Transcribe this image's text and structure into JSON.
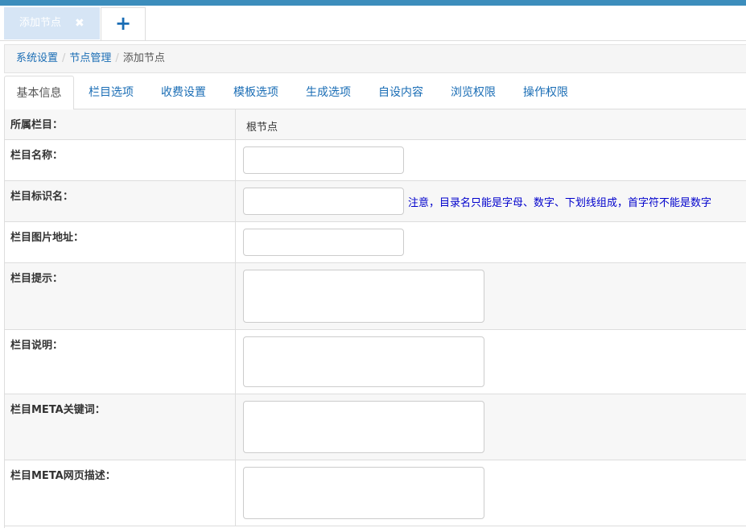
{
  "tabbar": {
    "page_tab_label": "添加节点",
    "close_glyph": "✖",
    "add_glyph": "+"
  },
  "breadcrumb": {
    "items": [
      "系统设置",
      "节点管理",
      "添加节点"
    ]
  },
  "tabs": [
    "基本信息",
    "栏目选项",
    "收费设置",
    "模板选项",
    "生成选项",
    "自设内容",
    "浏览权限",
    "操作权限"
  ],
  "form": {
    "parent_label": "所属栏目：",
    "parent_value": "根节点",
    "name_label": "栏目名称：",
    "name_value": "",
    "ident_label": "栏目标识名：",
    "ident_value": "",
    "ident_note": "注意，目录名只能是字母、数字、下划线组成，首字符不能是数字",
    "image_label": "栏目图片地址：",
    "image_value": "",
    "tip_label": "栏目提示：",
    "tip_value": "",
    "desc_label": "栏目说明：",
    "desc_value": "",
    "keywords_label": "栏目META关键词：",
    "keywords_value": "",
    "meta_desc_label": "栏目META网页描述：",
    "meta_desc_value": ""
  },
  "colors": {
    "accent": "#3c8dbc",
    "link": "#1a6db5",
    "note": "#0000cc",
    "active_page_tab": "#d6e5f5"
  }
}
